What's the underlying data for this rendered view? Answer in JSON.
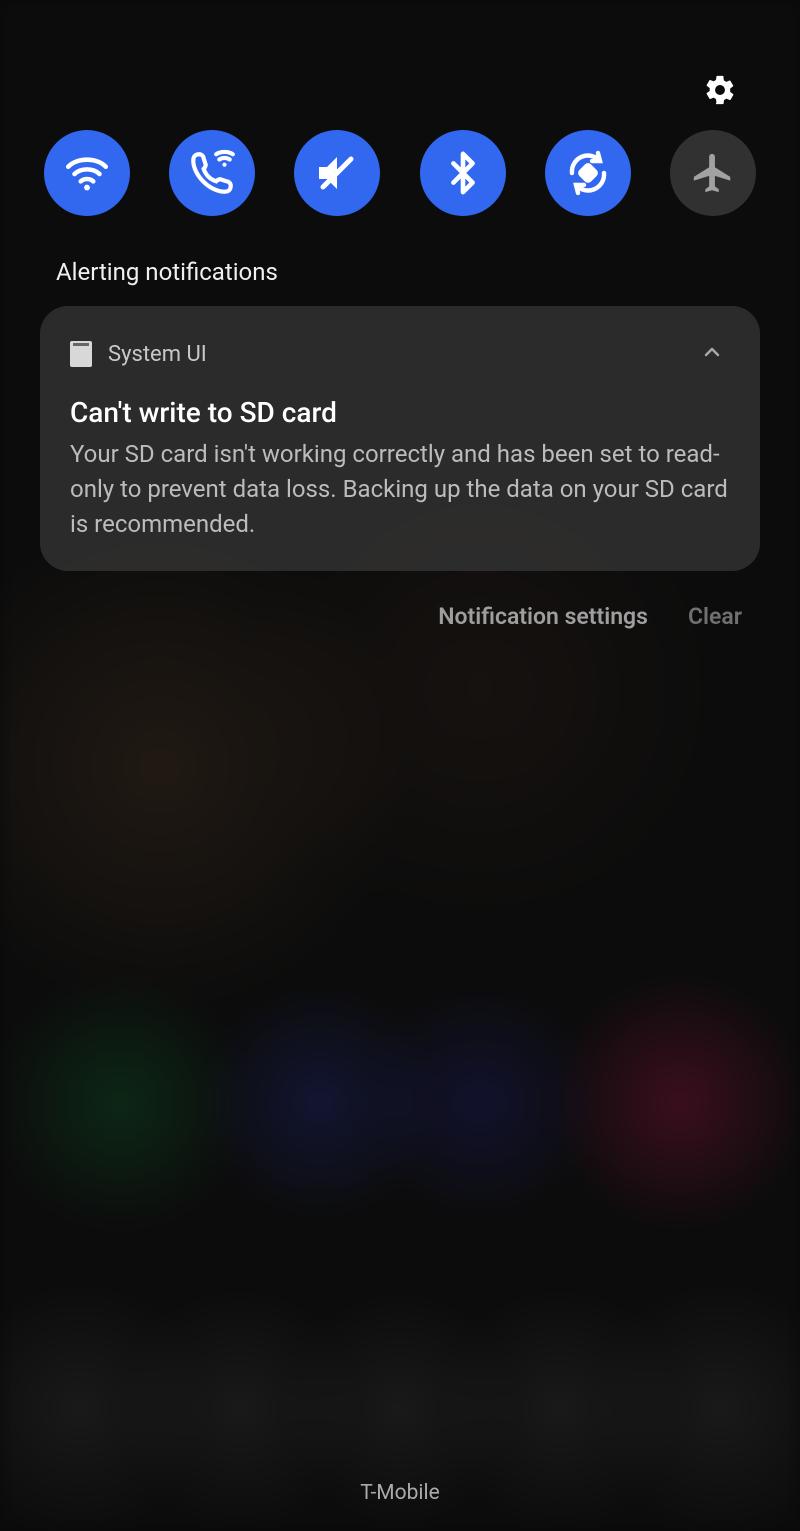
{
  "quick_settings": {
    "tiles": [
      {
        "name": "wifi",
        "active": true
      },
      {
        "name": "wifi-calling",
        "active": true
      },
      {
        "name": "mute",
        "active": true
      },
      {
        "name": "bluetooth",
        "active": true
      },
      {
        "name": "auto-rotate",
        "active": true
      },
      {
        "name": "airplane-mode",
        "active": false
      }
    ]
  },
  "section_header": "Alerting notifications",
  "notification": {
    "app_name": "System UI",
    "title": "Can't write to SD card",
    "body": "Your SD card isn't working correctly and has been set to read-only to prevent data loss. Backing up the data on your SD card is recommended."
  },
  "actions": {
    "settings_label": "Notification settings",
    "clear_label": "Clear"
  },
  "carrier": "T-Mobile"
}
